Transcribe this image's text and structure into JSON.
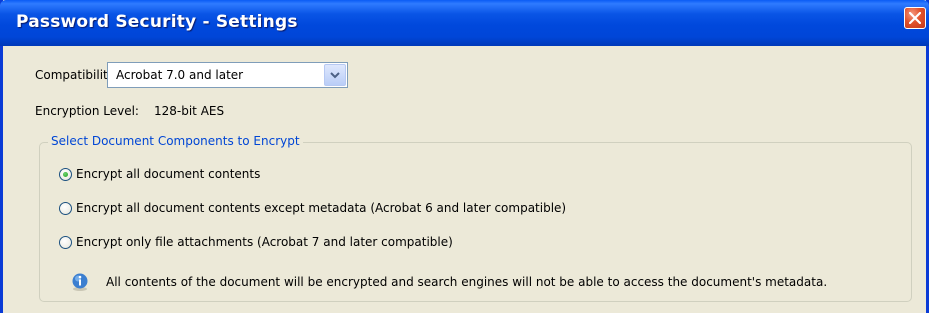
{
  "window": {
    "title": "Password Security - Settings"
  },
  "compatibility": {
    "label": "Compatibility:",
    "selected": "Acrobat 7.0 and later"
  },
  "encryption": {
    "label": "Encryption Level:",
    "value": "128-bit AES"
  },
  "components_group": {
    "legend": "Select Document Components to Encrypt",
    "options": [
      {
        "label": "Encrypt all document contents",
        "selected": true
      },
      {
        "label": "Encrypt all document contents except metadata (Acrobat 6 and later compatible)",
        "selected": false
      },
      {
        "label": "Encrypt only file attachments (Acrobat 7 and later compatible)",
        "selected": false
      }
    ],
    "info_text": "All contents of the document will be encrypted and search engines will not be able to access the document's metadata."
  },
  "colors": {
    "title_bar": "#0046d8",
    "window_bg": "#ece9d8",
    "legend_text": "#0046d5",
    "close_button": "#e2522b"
  }
}
